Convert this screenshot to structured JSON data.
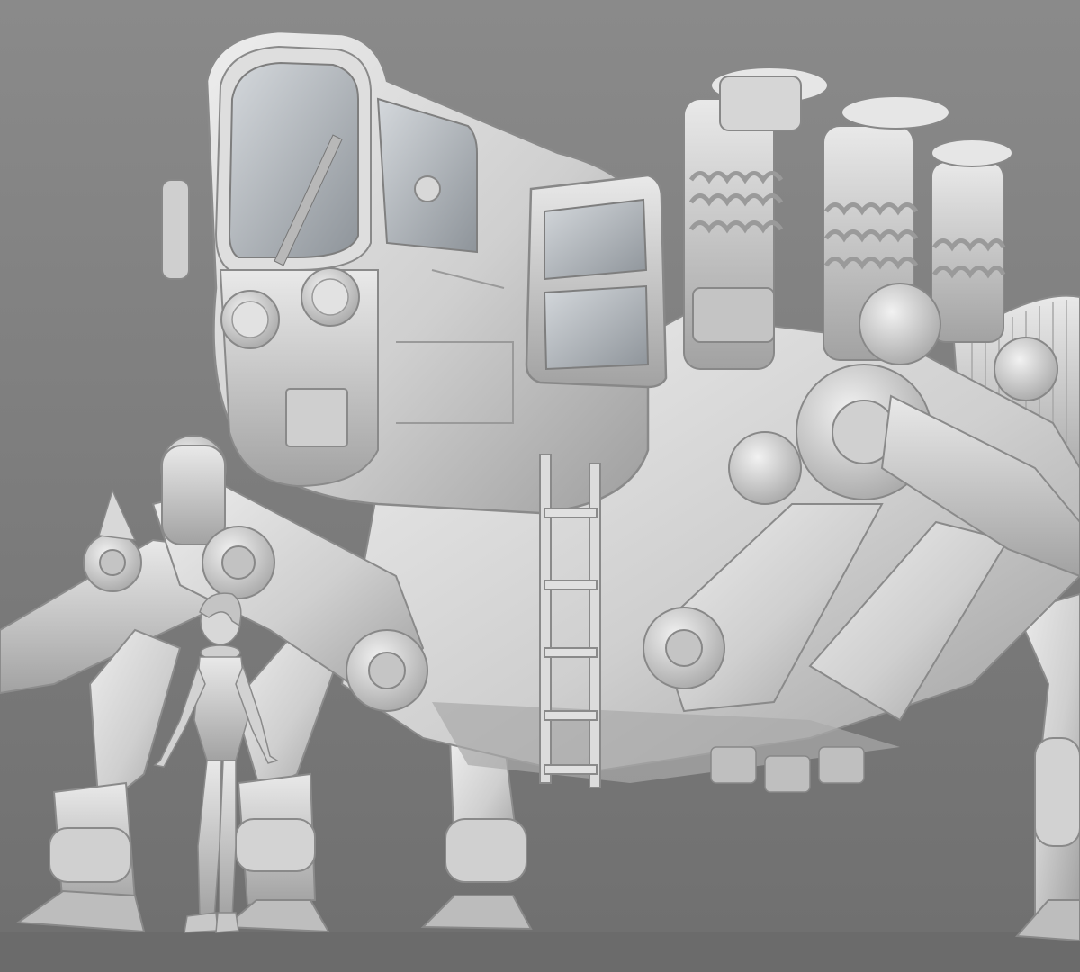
{
  "scene": {
    "subject": "mech-walker-render",
    "colors": {
      "background_top": "#8a8a8a",
      "background_bottom": "#6f6f6f",
      "floor": "#6a6a6a",
      "clay_light": "#e6e6e6",
      "clay_mid": "#c8c8c8",
      "clay_dark": "#9a9a9a",
      "clay_shadow": "#7e7e7e",
      "glass": "#b9bec4"
    }
  }
}
